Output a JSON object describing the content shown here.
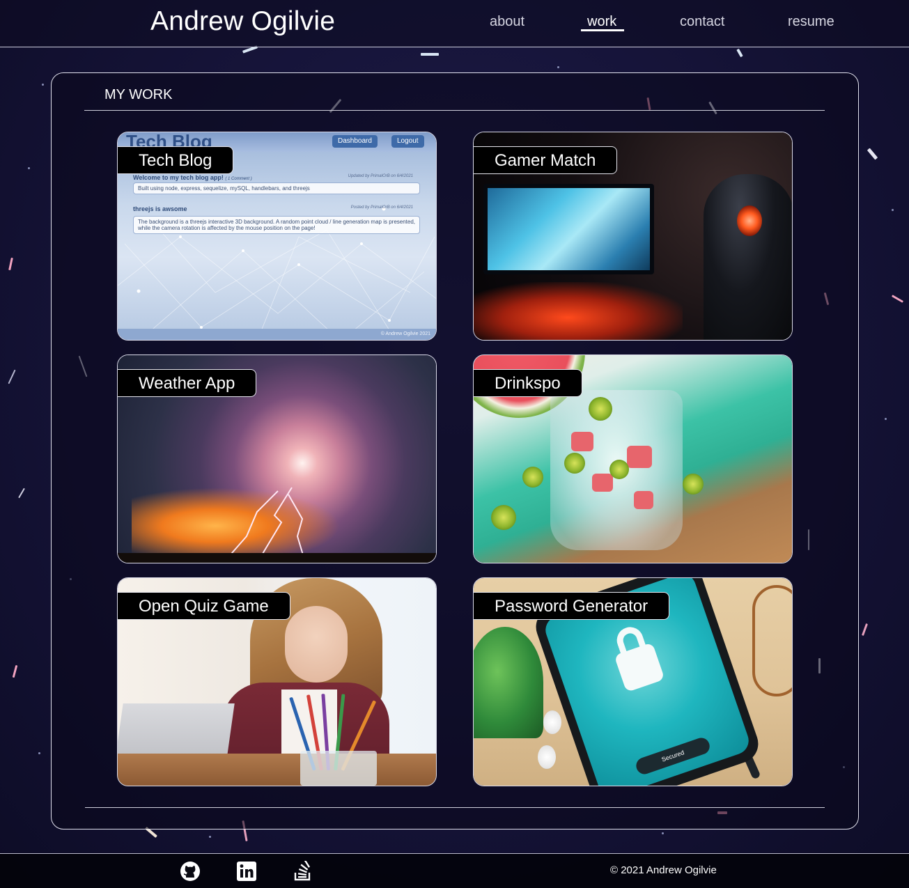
{
  "header": {
    "brand": "Andrew Ogilvie",
    "nav": [
      {
        "label": "about",
        "active": false
      },
      {
        "label": "work",
        "active": true
      },
      {
        "label": "contact",
        "active": false
      },
      {
        "label": "resume",
        "active": false
      }
    ]
  },
  "section": {
    "title": "MY WORK"
  },
  "projects": [
    {
      "title": "Tech Blog",
      "image": "tech-blog-screenshot"
    },
    {
      "title": "Gamer Match",
      "image": "gamer-at-monitor-photo"
    },
    {
      "title": "Weather App",
      "image": "lightning-storm-photo"
    },
    {
      "title": "Drinkspo",
      "image": "watermelon-drink-photo"
    },
    {
      "title": "Open Quiz Game",
      "image": "student-with-pencil-photo"
    },
    {
      "title": "Password Generator",
      "image": "secured-phone-photo"
    }
  ],
  "tech_blog_preview": {
    "title": "Tech Blog",
    "buttons": [
      "Dashboard",
      "Logout"
    ],
    "posts": [
      {
        "title": "Welcome to my tech blog app!",
        "comments": "( 1 Comment )",
        "meta": "Updated by PrimalOrB on 6/4/2021",
        "body": "Built using node, express, sequelize, mySQL, handlebars, and threejs"
      },
      {
        "title": "threejs is awsome",
        "comments": "",
        "meta": "Posted by PrimalOrB on 6/4/2021",
        "body": "The background is a threejs interactive 3D background. A random point cloud / line generation map is presented, while the camera rotation is affected by the mouse position on the page!"
      }
    ],
    "footer": "© Andrew Ogilvie 2021"
  },
  "password_preview": {
    "badge": "Secured"
  },
  "footer": {
    "social": [
      {
        "icon": "github-icon"
      },
      {
        "icon": "linkedin-icon"
      },
      {
        "icon": "stackoverflow-icon"
      }
    ],
    "copyright": "© 2021 Andrew Ogilvie"
  },
  "colors": {
    "background": "#151337",
    "text": "#ffffff",
    "card_label_bg": "#000000"
  }
}
